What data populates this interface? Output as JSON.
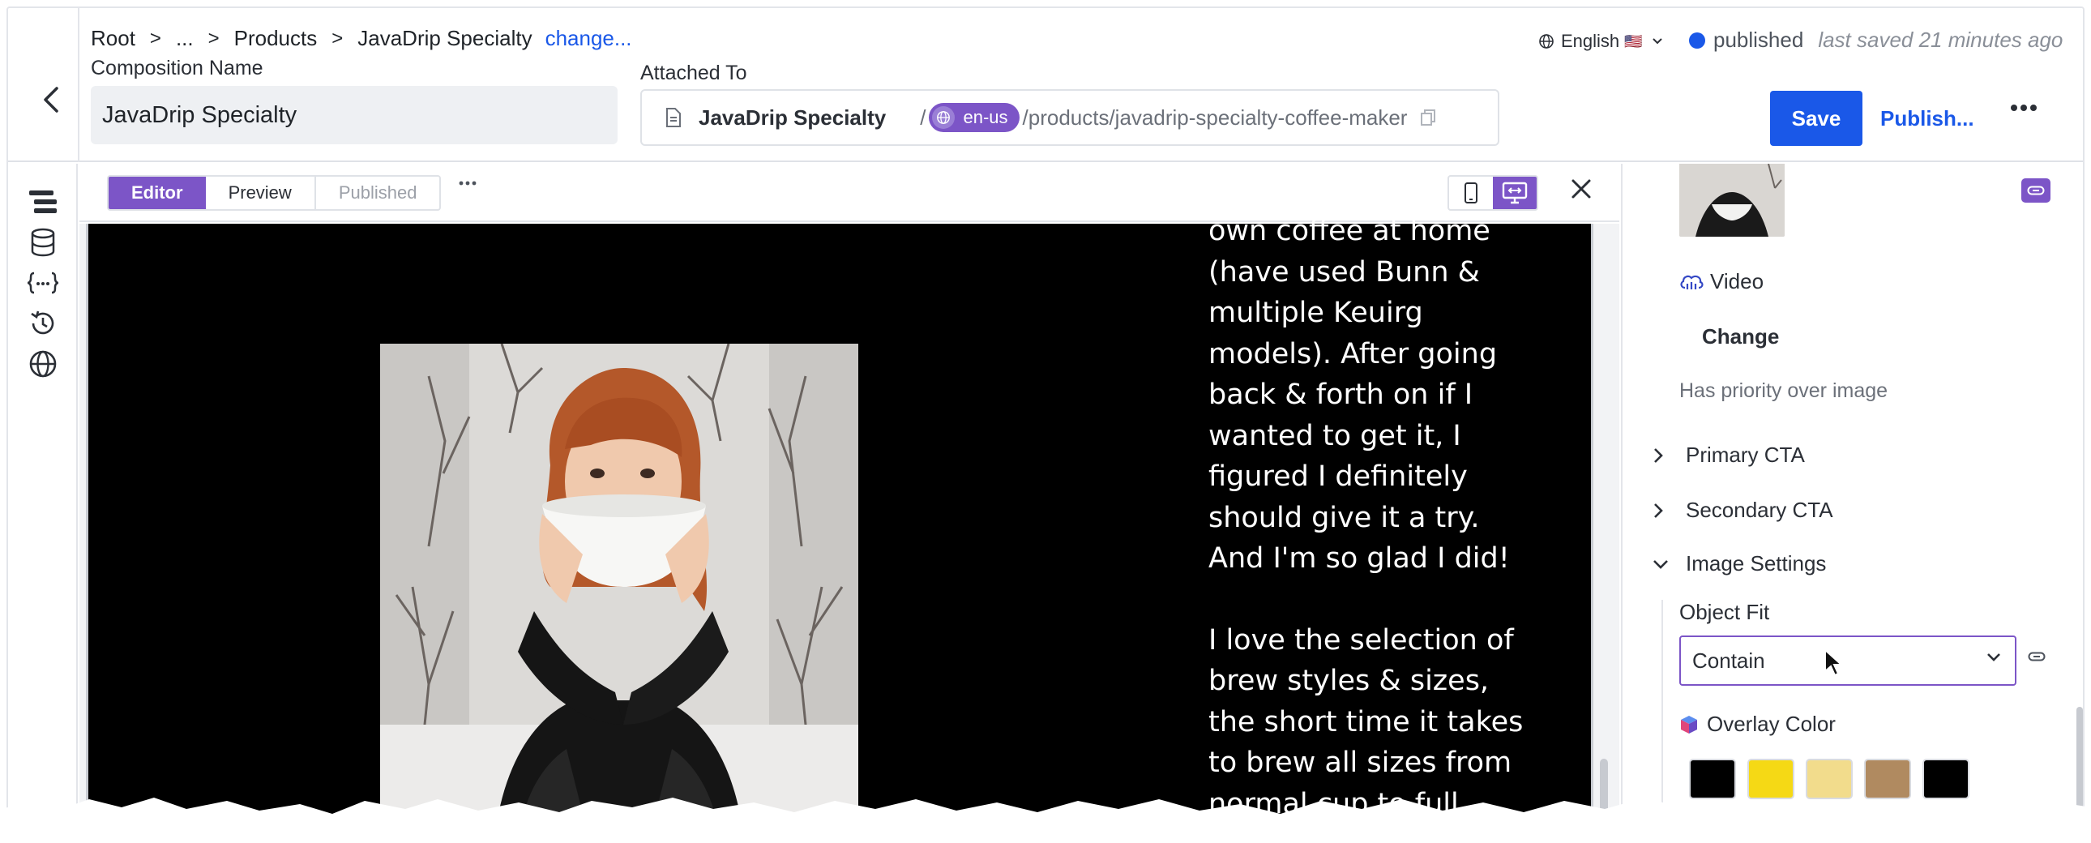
{
  "breadcrumbs": {
    "items": [
      "Root",
      "...",
      "Products",
      "JavaDrip Specialty"
    ],
    "separator": ">",
    "change_link": "change..."
  },
  "composition": {
    "label": "Composition Name",
    "value": "JavaDrip Specialty"
  },
  "attached_to": {
    "label": "Attached To",
    "entry_name": "JavaDrip Specialty",
    "slash": "/",
    "locale": "en-us",
    "path": "/products/javadrip-specialty-coffee-maker"
  },
  "language": {
    "label": "English",
    "flag": "🇺🇸"
  },
  "status": {
    "state": "published",
    "last_saved": "last saved 21 minutes ago",
    "color": "#1a58e8"
  },
  "actions": {
    "save": "Save",
    "publish": "Publish..."
  },
  "rail": {
    "items": [
      "structure-icon",
      "database-icon",
      "json-braces-icon",
      "history-icon",
      "globe-icon"
    ]
  },
  "toolbar": {
    "tabs": [
      "Editor",
      "Preview",
      "Published"
    ],
    "active_tab": "Editor"
  },
  "preview": {
    "quote_para1": "own coffee at home\n(have used Bunn &\nmultiple Keuirg\nmodels). After going\nback & forth on if I\nwanted to get it, I\nfigured I definitely\nshould give it a try.\nAnd I'm so glad I did!",
    "quote_para2": "I love the selection of\nbrew styles & sizes,\nthe short time it takes\nto brew all sizes from\nnormal cup to full"
  },
  "panel": {
    "video_label": "Video",
    "change_label": "Change",
    "video_help": "Has priority over image",
    "sections": {
      "primary_cta": "Primary CTA",
      "secondary_cta": "Secondary CTA",
      "image_settings": "Image Settings"
    },
    "object_fit": {
      "label": "Object Fit",
      "value": "Contain"
    },
    "overlay_color": {
      "label": "Overlay Color",
      "swatches": [
        "#000000",
        "#f5d915",
        "#f2dc8c",
        "#b08a60",
        "#000000"
      ]
    }
  },
  "colors": {
    "accent": "#7c55c7",
    "primary": "#1a58e8"
  }
}
